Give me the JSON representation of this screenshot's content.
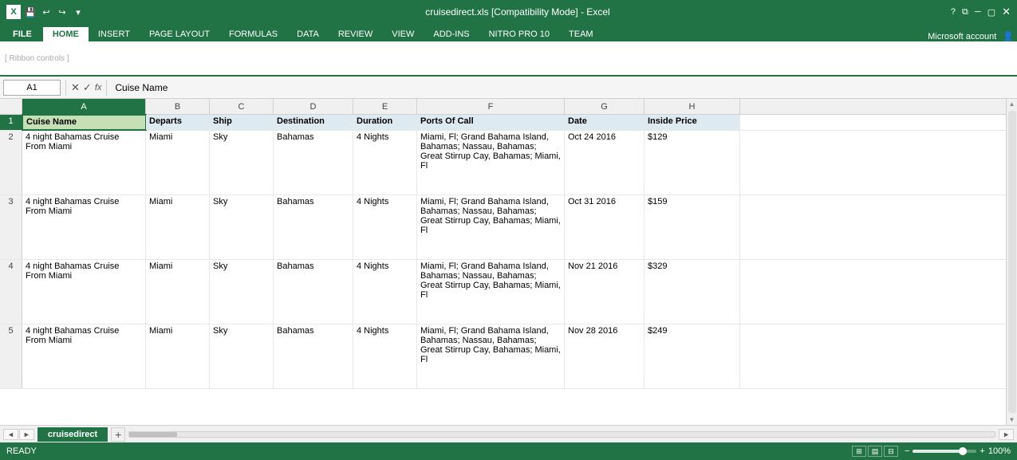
{
  "titlebar": {
    "filename": "cruisedirect.xls  [Compatibility Mode] - Excel",
    "help": "?",
    "account": "Microsoft account"
  },
  "quickaccess": {
    "save": "💾",
    "undo": "↩",
    "redo": "↪",
    "dropdown": "▾"
  },
  "ribbon_tabs": [
    "FILE",
    "HOME",
    "INSERT",
    "PAGE LAYOUT",
    "FORMULAS",
    "DATA",
    "REVIEW",
    "VIEW",
    "ADD-INS",
    "NITRO PRO 10",
    "TEAM"
  ],
  "active_tab": "HOME",
  "formula_bar": {
    "name_box": "A1",
    "formula": "Cuise Name"
  },
  "columns": {
    "headers": [
      "A",
      "B",
      "C",
      "D",
      "E",
      "F",
      "G",
      "H"
    ],
    "active": "A"
  },
  "header_row": {
    "cells": [
      "Cuise Name",
      "Departs",
      "Ship",
      "Destination",
      "Duration",
      "Ports Of Call",
      "Date",
      "Inside Price"
    ]
  },
  "rows": [
    {
      "row_num": "1",
      "cells": [
        "Cuise Name",
        "Departs",
        "Ship",
        "Destination",
        "Duration",
        "Ports Of Call",
        "Date",
        "Inside Price"
      ],
      "is_header": true
    },
    {
      "row_num": "2",
      "col_a": "4 night Bahamas Cruise\nFrom Miami",
      "col_b": "Miami",
      "col_c": "Sky",
      "col_d": "Bahamas",
      "col_e": "4 Nights",
      "col_f": "Miami, Fl; Grand Bahama Island, Bahamas; Nassau, Bahamas; Great Stirrup Cay, Bahamas; Miami, Fl",
      "col_g": "Oct 24 2016",
      "col_h": "$129"
    },
    {
      "row_num": "3",
      "col_a": "4 night Bahamas Cruise\nFrom Miami",
      "col_b": "Miami",
      "col_c": "Sky",
      "col_d": "Bahamas",
      "col_e": "4 Nights",
      "col_f": "Miami, Fl; Grand Bahama Island, Bahamas; Nassau, Bahamas; Great Stirrup Cay, Bahamas; Miami, Fl",
      "col_g": "Oct 31 2016",
      "col_h": "$159"
    },
    {
      "row_num": "4",
      "col_a": "4 night Bahamas Cruise\nFrom Miami",
      "col_b": "Miami",
      "col_c": "Sky",
      "col_d": "Bahamas",
      "col_e": "4 Nights",
      "col_f": "Miami, Fl; Grand Bahama Island, Bahamas; Nassau, Bahamas; Great Stirrup Cay, Bahamas; Miami, Fl",
      "col_g": "Nov 21 2016",
      "col_h": "$329"
    },
    {
      "row_num": "5",
      "col_a": "4 night Bahamas Cruise\nFrom Miami",
      "col_b": "Miami",
      "col_c": "Sky",
      "col_d": "Bahamas",
      "col_e": "4 Nights",
      "col_f": "Miami, Fl; Grand Bahama Island, Bahamas; Nassau, Bahamas; Great Stirrup Cay, Bahamas; Miami, Fl",
      "col_g": "Nov 28 2016",
      "col_h": "$249"
    }
  ],
  "sheet_tabs": [
    "cruisedirect"
  ],
  "active_sheet": "cruisedirect",
  "status": {
    "ready": "READY",
    "zoom": "100%"
  }
}
